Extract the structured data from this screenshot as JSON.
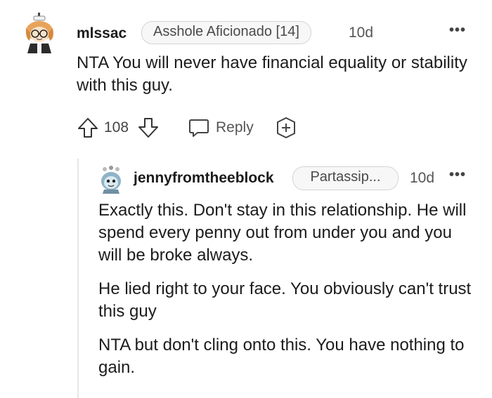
{
  "comment": {
    "username": "mlssac",
    "flair": "Asshole Aficionado [14]",
    "time": "10d",
    "more": "•••",
    "body": "NTA You will never have financial equality or stability with this guy.",
    "score": "108",
    "reply_label": "Reply",
    "avatar_icon": "avatar-icon",
    "upvote_icon": "arrow-up-icon",
    "downvote_icon": "arrow-down-icon",
    "reply_icon": "speech-bubble-icon",
    "award_icon": "award-plus-icon"
  },
  "reply": {
    "username": "jennyfromtheeblock",
    "flair": "Partassip...",
    "time": "10d",
    "more": "•••",
    "paragraphs": [
      "Exactly this. Don't stay in this relationship. He will spend every penny out from under you and you will be broke always.",
      "He lied right to your face. You obviously can't trust this guy",
      "NTA but don't cling onto this. You have nothing to gain."
    ],
    "avatar_icon": "avatar-icon"
  },
  "colors": {
    "text": "#1c1c1c",
    "muted": "#555555",
    "flair_bg": "#f7f7f7",
    "flair_border": "#d4d4d4",
    "thread_line": "#e6e6e6"
  }
}
